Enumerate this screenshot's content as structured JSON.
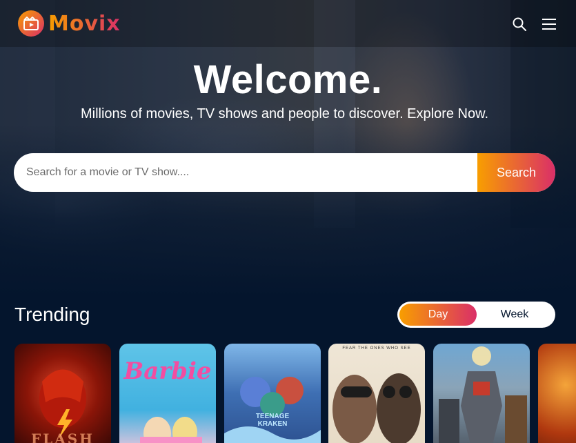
{
  "app": {
    "logo_text": "Movix",
    "nav_icons": [
      "search-icon",
      "hamburger-menu-icon"
    ]
  },
  "hero": {
    "title": "Welcome.",
    "subtitle": "Millions of movies, TV shows and people to discover. Explore Now.",
    "search": {
      "placeholder": "Search for a movie or TV show....",
      "value": "",
      "button_label": "Search"
    }
  },
  "trending": {
    "title": "Trending",
    "tabs": [
      "Day",
      "Week"
    ],
    "active_tab": "Day",
    "posters": [
      {
        "name": "poster-the-flash",
        "text": "FLASH"
      },
      {
        "name": "poster-barbie",
        "text": "Barbie"
      },
      {
        "name": "poster-ruby-gillman",
        "text": "TEENAGE KRAKEN"
      },
      {
        "name": "poster-oppenheimer",
        "text": "FEAR THE ONES WHO SEE"
      },
      {
        "name": "poster-transformers",
        "text": ""
      },
      {
        "name": "poster-partial",
        "text": ""
      }
    ]
  },
  "colors": {
    "background": "#04152d",
    "accent_start": "#f89e00",
    "accent_end": "#da2f68"
  }
}
